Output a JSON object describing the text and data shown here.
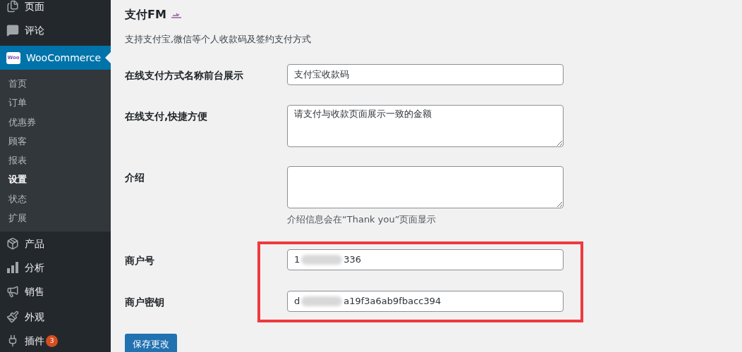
{
  "sidebar": {
    "items": [
      {
        "label": "页面",
        "selected": false
      },
      {
        "label": "评论",
        "selected": false
      },
      {
        "label": "WooCommerce",
        "logo_text": "Woo",
        "selected": true,
        "children": [
          {
            "label": "首页",
            "selected": false
          },
          {
            "label": "订单",
            "selected": false
          },
          {
            "label": "优惠券",
            "selected": false
          },
          {
            "label": "顾客",
            "selected": false
          },
          {
            "label": "报表",
            "selected": false
          },
          {
            "label": "设置",
            "selected": true
          },
          {
            "label": "状态",
            "selected": false
          },
          {
            "label": "扩展",
            "selected": false
          }
        ]
      },
      {
        "label": "产品",
        "selected": false
      },
      {
        "label": "分析",
        "selected": false
      },
      {
        "label": "销售",
        "selected": false
      },
      {
        "label": "外观",
        "selected": false
      },
      {
        "label": "插件",
        "badge": "3",
        "selected": false
      }
    ]
  },
  "content": {
    "title": "支付FM",
    "description": "支持支付宝,微信等个人收款码及签约支付方式",
    "fields": [
      {
        "kind": "input",
        "label": "在线支付方式名称前台展示",
        "value": "支付宝收款码"
      },
      {
        "kind": "textarea",
        "label": "在线支付,快捷方便",
        "value": "请支付与收款页面展示一致的金额"
      },
      {
        "kind": "textarea",
        "label": "介绍",
        "hint": "介绍信息会在“Thank you”页面显示"
      },
      {
        "kind": "redacted",
        "label": "商户号",
        "value_start": "1",
        "value_end": "336"
      },
      {
        "kind": "redacted",
        "label": "商户密钥",
        "value_start": "d",
        "value_end": "a19f3a6ab9fbacc394"
      }
    ],
    "save_button": "保存更改",
    "annotation": {
      "kind": "frame",
      "color": "#ef3a3f"
    }
  }
}
